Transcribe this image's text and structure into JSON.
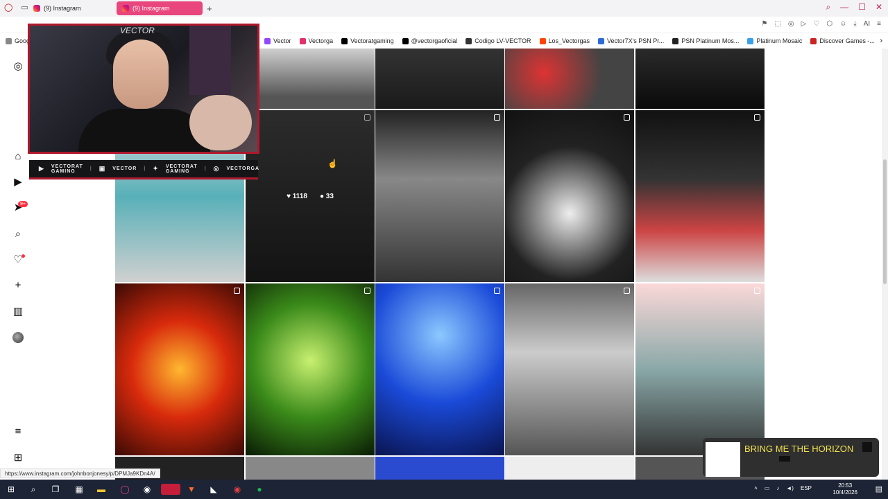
{
  "tabs": [
    {
      "label": "(9) Instagram",
      "active": false
    },
    {
      "label": "(9) Instagram",
      "active": true
    }
  ],
  "new_tab_icon": "+",
  "window_controls": [
    "search-icon",
    "minimize-icon",
    "maximize-icon",
    "close-icon"
  ],
  "bookmarks": [
    "Goog",
    "Vector",
    "Vectorga",
    "Vectoratgaming",
    "@vectorgaoficial",
    "Codigo LV-VECTOR",
    "Los_Vectorgas",
    "Vector7X's PSN Pr...",
    "PSN Platinum Mos...",
    "Platinum Mosaic",
    "Discover Games -..."
  ],
  "sidebar_icons": [
    "instagram-logo-icon",
    "home-icon",
    "reels-icon",
    "messages-icon",
    "search-icon",
    "notifications-icon",
    "create-icon",
    "dashboard-icon",
    "profile-avatar",
    "menu-icon",
    "meta-icon"
  ],
  "messages_badge": "9+",
  "grid": {
    "hover_post": {
      "likes": "1118",
      "comments": "33"
    }
  },
  "overlay": {
    "webcam_title": "VECTOR",
    "social_links": [
      {
        "icon": "youtube-icon",
        "label": "VECTORAT GAMING"
      },
      {
        "icon": "twitch-icon",
        "label": "VECTOR"
      },
      {
        "icon": "twitter-icon",
        "label": "VECTORAT GAMING"
      },
      {
        "icon": "instagram-icon",
        "label": "VECTORGA"
      }
    ],
    "now_playing": "BRING ME THE HORIZON"
  },
  "status_url": "https://www.instagram.com/johnbonjonesy/p/DPMJa9KDn4A/",
  "taskbar": {
    "language": "ESP",
    "time": "20:53",
    "date": "10/4/2026"
  },
  "colors": {
    "accent": "#e8467c",
    "stream_red": "#b0182c",
    "taskbar": "#1d2435"
  }
}
